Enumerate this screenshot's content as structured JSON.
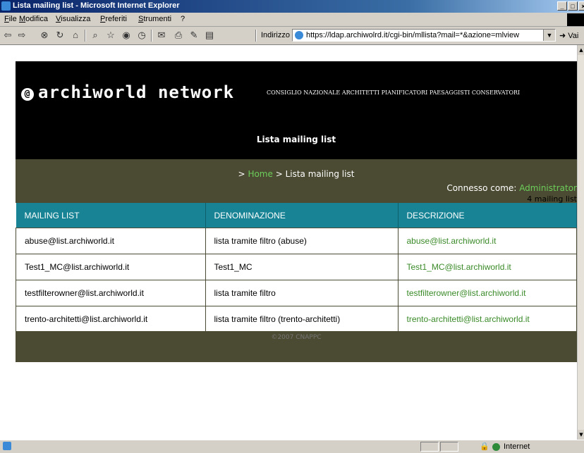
{
  "window": {
    "title": "Lista mailing list - Microsoft Internet Explorer",
    "min": "_",
    "max": "□",
    "close": "×"
  },
  "menu": [
    "File",
    "Modifica",
    "Visualizza",
    "Preferiti",
    "Strumenti",
    "?"
  ],
  "toolbar": {
    "address_label": "Indirizzo",
    "url": "https://ldap.archiwolrd.it/cgi-bin/mllista?mail=*&azione=mlview",
    "go_label": "Vai"
  },
  "site": {
    "logo": "archiworld network",
    "org": "CONSIGLIO NAZIONALE ARCHITETTI PIANIFICATORI PAESAGGISTI CONSERVATORI",
    "page_title": "Lista mailing list",
    "breadcrumb_prefix": ">",
    "breadcrumb_home": "Home",
    "breadcrumb_current": "> Lista mailing list",
    "connected_label": "Connesso come:",
    "connected_user": "Administrator",
    "count": "4 mailing list"
  },
  "table": {
    "headers": [
      "MAILING LIST",
      "DENOMINAZIONE",
      "DESCRIZIONE"
    ],
    "rows": [
      [
        "abuse@list.archiworld.it",
        "lista tramite filtro (abuse)",
        "abuse@list.archiworld.it"
      ],
      [
        "Test1_MC@list.archiworld.it",
        "Test1_MC",
        "Test1_MC@list.archiworld.it"
      ],
      [
        "testfilterowner@list.archiworld.it",
        "lista tramite filtro",
        "testfilterowner@list.archiworld.it"
      ],
      [
        "trento-architetti@list.archiworld.it",
        "lista tramite filtro (trento-architetti)",
        "trento-architetti@list.archiworld.it"
      ]
    ]
  },
  "footer": "©2007 CNAPPC",
  "status": {
    "zone": "Internet"
  }
}
